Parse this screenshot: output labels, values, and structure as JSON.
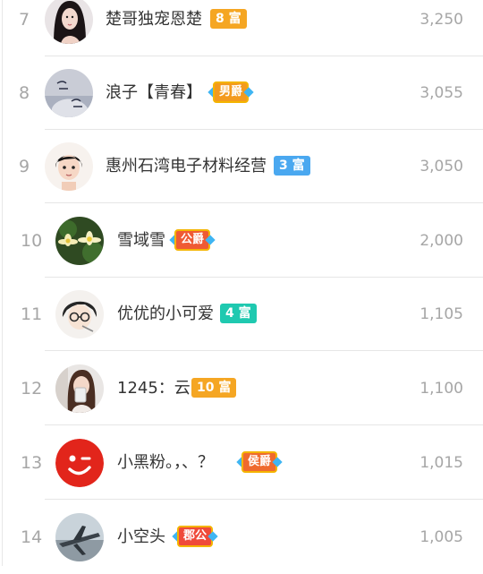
{
  "leaderboard": [
    {
      "rank": "7",
      "name": "楚哥独宠恩楚",
      "badge": "8 富",
      "badge_kind": "wealth",
      "badge_color": "#f5a623",
      "score": "3,250",
      "avatar_icon": "girl-portrait-avatar"
    },
    {
      "rank": "8",
      "name": "浪子【青春】",
      "badge": "男爵",
      "badge_kind": "noble",
      "badge_color": "#f39a1e",
      "score": "3,055",
      "avatar_icon": "handwritten-photo-avatar"
    },
    {
      "rank": "9",
      "name": "惠州石湾电子材料经营",
      "badge": "3 富",
      "badge_kind": "wealth",
      "badge_color": "#4aa8f0",
      "score": "3,050",
      "avatar_icon": "cartoon-boy-avatar"
    },
    {
      "rank": "10",
      "name": "雪域雪",
      "badge": "公爵",
      "badge_kind": "noble",
      "badge_color": "#ef5a34",
      "score": "2,000",
      "avatar_icon": "lotus-flower-avatar"
    },
    {
      "rank": "11",
      "name": "优优的小可爱",
      "badge": "4 富",
      "badge_kind": "wealth",
      "badge_color": "#1fc9b0",
      "score": "1,105",
      "avatar_icon": "anime-glasses-avatar"
    },
    {
      "rank": "12",
      "name": "1245：云",
      "badge": "10 富",
      "badge_kind": "wealth",
      "badge_color": "#f5a623",
      "score": "1,100",
      "avatar_icon": "girl-photo-avatar"
    },
    {
      "rank": "13",
      "name": "小黑粉。，、？",
      "badge": "侯爵",
      "badge_kind": "noble",
      "badge_color": "#ef6a2e",
      "score": "1,015",
      "avatar_icon": "wink-face-avatar"
    },
    {
      "rank": "14",
      "name": "小空头",
      "badge": "郡公",
      "badge_kind": "noble",
      "badge_color": "#ef4a3a",
      "score": "1,005",
      "avatar_icon": "airplane-avatar"
    }
  ]
}
